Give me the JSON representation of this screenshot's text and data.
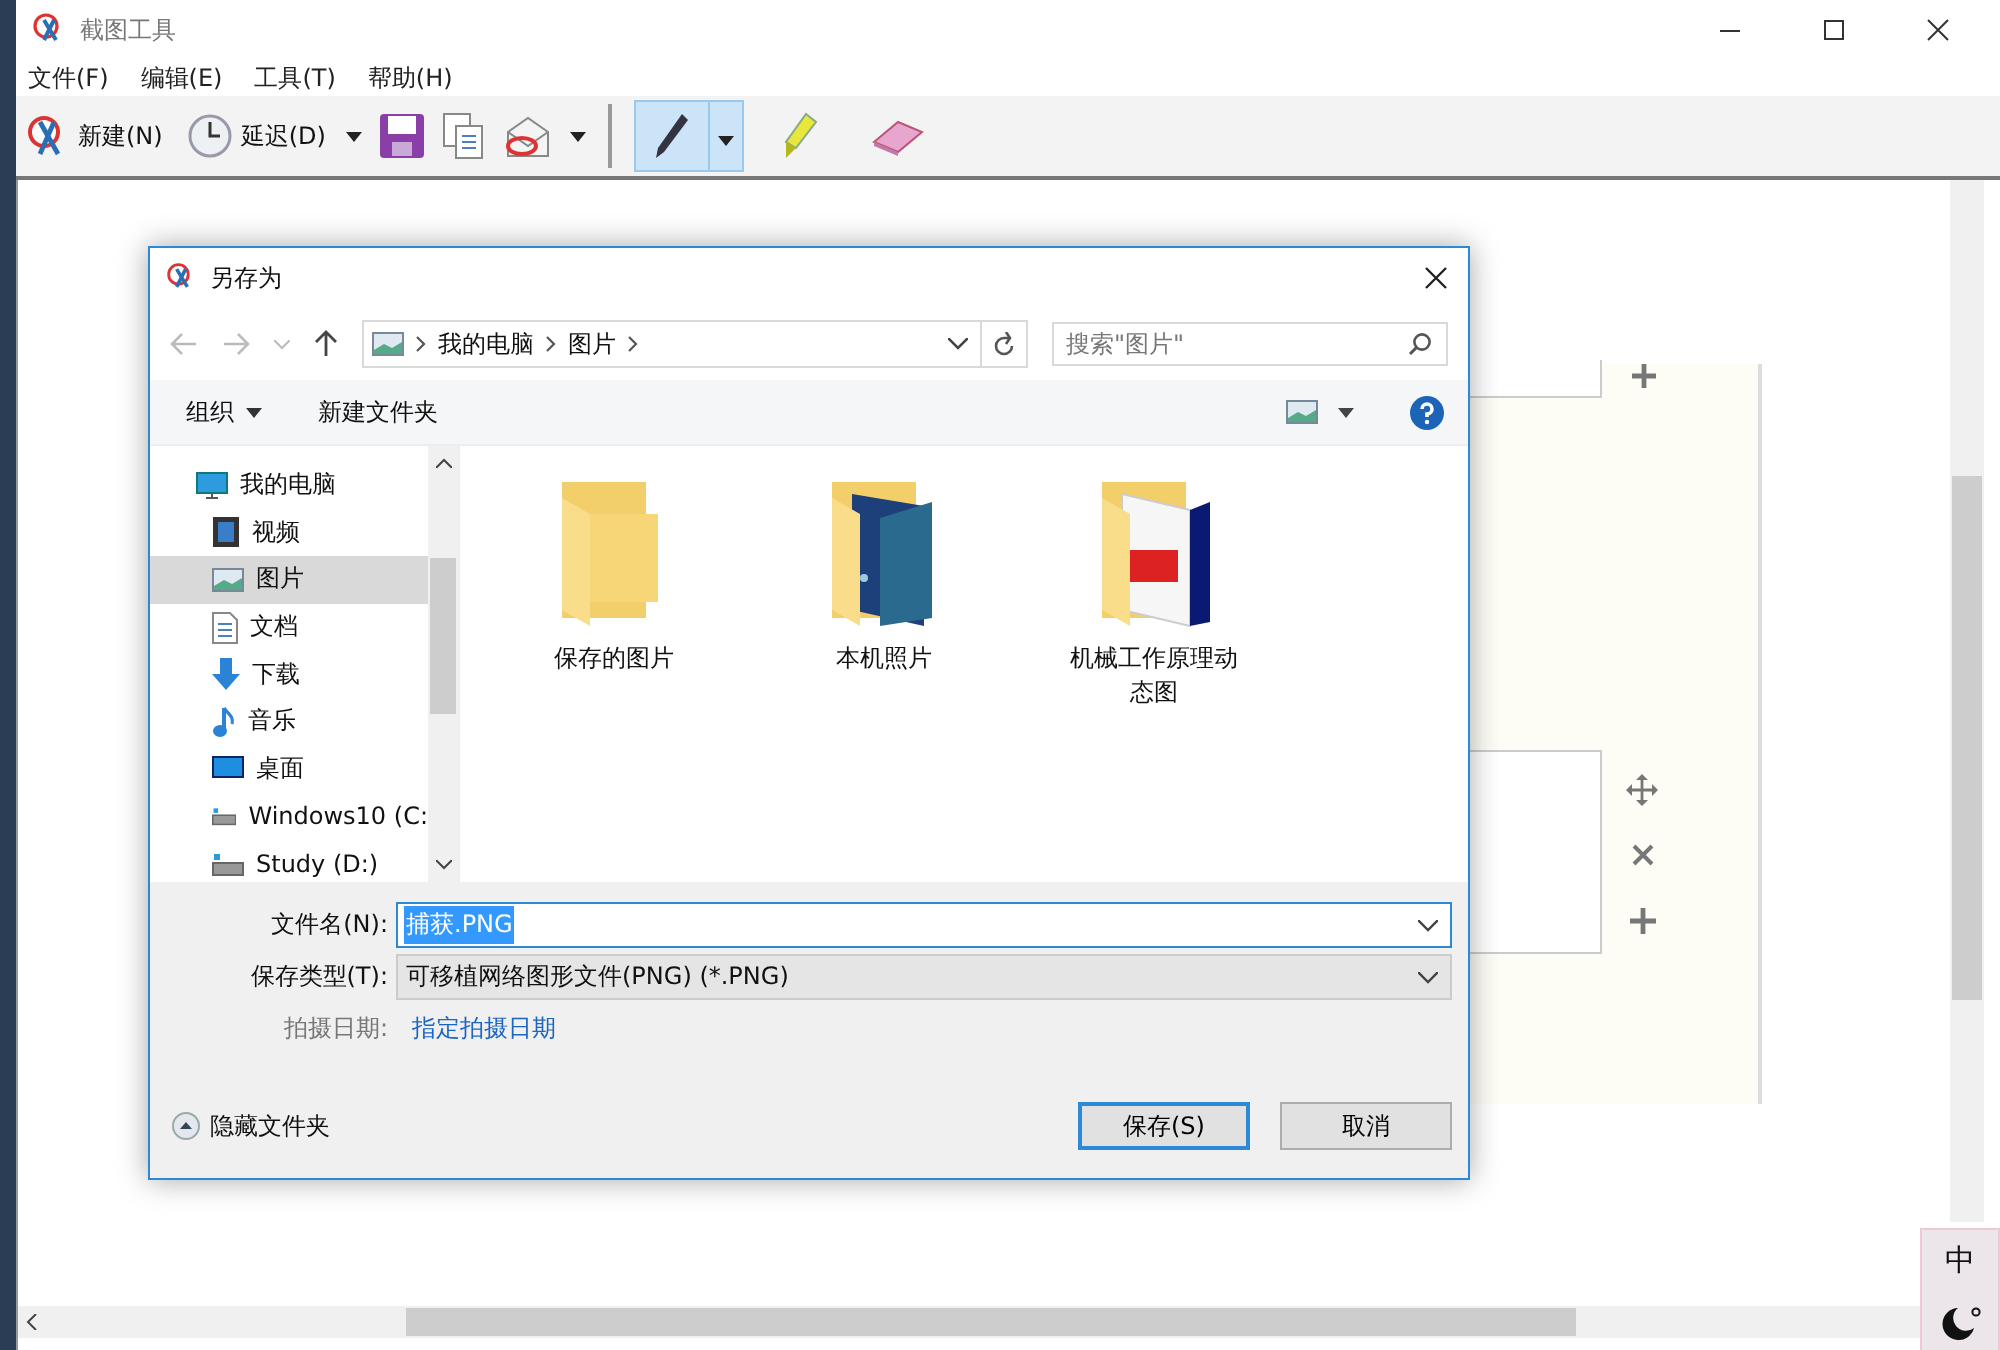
{
  "window": {
    "title": "截图工具"
  },
  "menu": [
    "文件(F)",
    "编辑(E)",
    "工具(T)",
    "帮助(H)"
  ],
  "toolbar": [
    {
      "kind": "new",
      "label": "新建(N)"
    },
    {
      "kind": "delay",
      "label": "延迟(D)"
    },
    {
      "kind": "save"
    },
    {
      "kind": "copy"
    },
    {
      "kind": "send"
    }
  ],
  "tools": [
    {
      "kind": "pen",
      "selected": true
    },
    {
      "kind": "highlighter",
      "selected": false
    },
    {
      "kind": "eraser",
      "selected": false
    }
  ],
  "dialog": {
    "title": "另存为",
    "breadcrumb": [
      "我的电脑",
      "图片"
    ],
    "search": {
      "placeholder": "搜索\"图片\""
    },
    "commands": [
      "组织",
      "新建文件夹"
    ],
    "nav": [
      {
        "label": "我的电脑",
        "kind": "computer",
        "selected": false,
        "children": [
          {
            "label": "视频",
            "kind": "video",
            "selected": false
          },
          {
            "label": "图片",
            "kind": "pictures",
            "selected": true
          },
          {
            "label": "文档",
            "kind": "document",
            "selected": false
          },
          {
            "label": "下载",
            "kind": "download",
            "selected": false
          },
          {
            "label": "音乐",
            "kind": "music",
            "selected": false
          },
          {
            "label": "桌面",
            "kind": "desktop",
            "selected": false
          },
          {
            "label": "Windows10 (C:",
            "kind": "drive",
            "selected": false
          },
          {
            "label": "Study (D:)",
            "kind": "drive",
            "selected": false
          }
        ]
      }
    ],
    "folders": [
      {
        "name": "保存的图片",
        "kind": "plain"
      },
      {
        "name": "本机照片",
        "kind": "night"
      },
      {
        "name": "机械工作原理动态图",
        "kind": "machine"
      }
    ],
    "filename": {
      "label": "文件名(N):",
      "value": "捕获.PNG",
      "text_selected": true
    },
    "filetype": {
      "label": "保存类型(T):",
      "value": "可移植网络图形文件(PNG) (*.PNG)"
    },
    "date": {
      "label": "拍摄日期:",
      "link": "指定拍摄日期"
    },
    "hide_folders": "隐藏文件夹",
    "buttons": [
      {
        "label": "保存(S)",
        "default": true
      },
      {
        "label": "取消",
        "default": false
      }
    ]
  },
  "ime": {
    "label": "中"
  }
}
